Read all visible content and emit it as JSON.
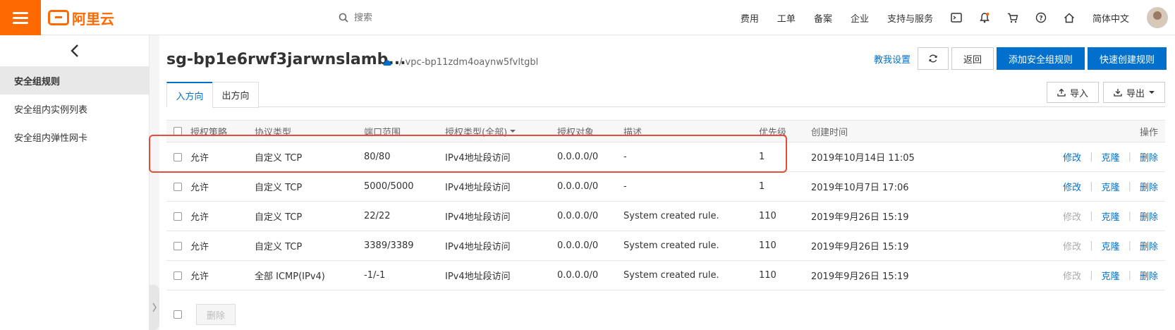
{
  "brand": {
    "name": "阿里云",
    "accent": "#ff6a00",
    "link_color": "#0070cc"
  },
  "search": {
    "placeholder": "搜索"
  },
  "nav": {
    "items": [
      "费用",
      "工单",
      "备案",
      "企业",
      "支持与服务"
    ],
    "icons": [
      "terminal-icon",
      "bell-icon",
      "cart-icon",
      "help-icon",
      "home-icon"
    ],
    "language": "简体中文"
  },
  "sidebar": {
    "items": [
      {
        "label": "安全组规则",
        "active": true
      },
      {
        "label": "安全组内实例列表",
        "active": false
      },
      {
        "label": "安全组内弹性网卡",
        "active": false
      }
    ]
  },
  "page": {
    "title": "sg-bp1e6rwf3jarwnslamb...",
    "vpc": "/ vpc-bp11zdm4oaynw5fvltgbl",
    "teach_link": "教我设置",
    "back_button": "返回",
    "add_rule_button": "添加安全组规则",
    "quick_create_button": "快速创建规则",
    "import_button": "导入",
    "export_button": "导出",
    "tabs": [
      {
        "label": "入方向",
        "active": true
      },
      {
        "label": "出方向",
        "active": false
      }
    ],
    "delete_button": "删除"
  },
  "table": {
    "headers": [
      "授权策略",
      "协议类型",
      "端口范围",
      "授权类型(全部)",
      "授权对象",
      "描述",
      "优先级",
      "创建时间",
      "操作"
    ],
    "ops": {
      "modify": "修改",
      "clone": "克隆",
      "delete": "删除"
    },
    "rows": [
      {
        "policy": "允许",
        "protocol": "自定义 TCP",
        "port": "80/80",
        "auth_type": "IPv4地址段访问",
        "object": "0.0.0.0/0",
        "desc": "-",
        "priority": "1",
        "created": "2019年10月14日 11:05",
        "modify_enabled": true
      },
      {
        "policy": "允许",
        "protocol": "自定义 TCP",
        "port": "5000/5000",
        "auth_type": "IPv4地址段访问",
        "object": "0.0.0.0/0",
        "desc": "-",
        "priority": "1",
        "created": "2019年10月7日 17:06",
        "modify_enabled": true
      },
      {
        "policy": "允许",
        "protocol": "自定义 TCP",
        "port": "22/22",
        "auth_type": "IPv4地址段访问",
        "object": "0.0.0.0/0",
        "desc": "System created rule.",
        "priority": "110",
        "created": "2019年9月26日 15:19",
        "modify_enabled": false
      },
      {
        "policy": "允许",
        "protocol": "自定义 TCP",
        "port": "3389/3389",
        "auth_type": "IPv4地址段访问",
        "object": "0.0.0.0/0",
        "desc": "System created rule.",
        "priority": "110",
        "created": "2019年9月26日 15:19",
        "modify_enabled": false
      },
      {
        "policy": "允许",
        "protocol": "全部 ICMP(IPv4)",
        "port": "-1/-1",
        "auth_type": "IPv4地址段访问",
        "object": "0.0.0.0/0",
        "desc": "System created rule.",
        "priority": "110",
        "created": "2019年9月26日 15:19",
        "modify_enabled": false
      }
    ]
  }
}
